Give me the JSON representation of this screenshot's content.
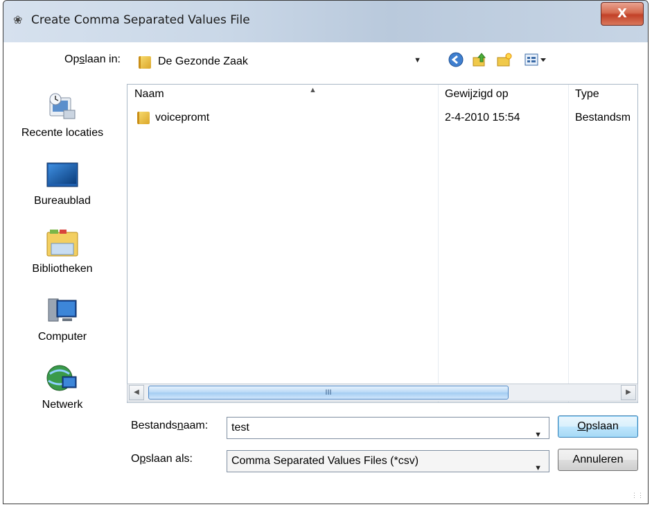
{
  "window": {
    "title": "Create Comma Separated Values File",
    "close_glyph": "X"
  },
  "lookin": {
    "label_pre": "Op",
    "label_ul": "s",
    "label_post": "laan in:",
    "value": "De Gezonde Zaak"
  },
  "toolbar": {
    "icons": [
      "back-icon",
      "up-folder-icon",
      "new-folder-icon",
      "view-menu-icon"
    ]
  },
  "places": [
    {
      "label": "Recente locaties",
      "icon": "recent-places-icon"
    },
    {
      "label": "Bureaublad",
      "icon": "desktop-icon"
    },
    {
      "label": "Bibliotheken",
      "icon": "libraries-icon"
    },
    {
      "label": "Computer",
      "icon": "computer-icon"
    },
    {
      "label": "Netwerk",
      "icon": "network-icon"
    }
  ],
  "filelist": {
    "columns": [
      "Naam",
      "Gewijzigd op",
      "Type"
    ],
    "rows": [
      {
        "name": "voicepromt",
        "modified": "2-4-2010 15:54",
        "type": "Bestandsm"
      }
    ],
    "scroll_thumb_glyph": "III"
  },
  "filename": {
    "label_pre": "Bestands",
    "label_ul": "n",
    "label_post": "aam:",
    "value": "test"
  },
  "savetype": {
    "label_pre": "O",
    "label_ul": "p",
    "label_post": "slaan als:",
    "value": "Comma Separated Values Files (*csv)"
  },
  "buttons": {
    "save_ul": "O",
    "save_post": "pslaan",
    "cancel": "Annuleren"
  },
  "colors": {
    "titlebar": "#c9d7e7",
    "close": "#c24128",
    "default_button_border": "#3c7fb1"
  }
}
